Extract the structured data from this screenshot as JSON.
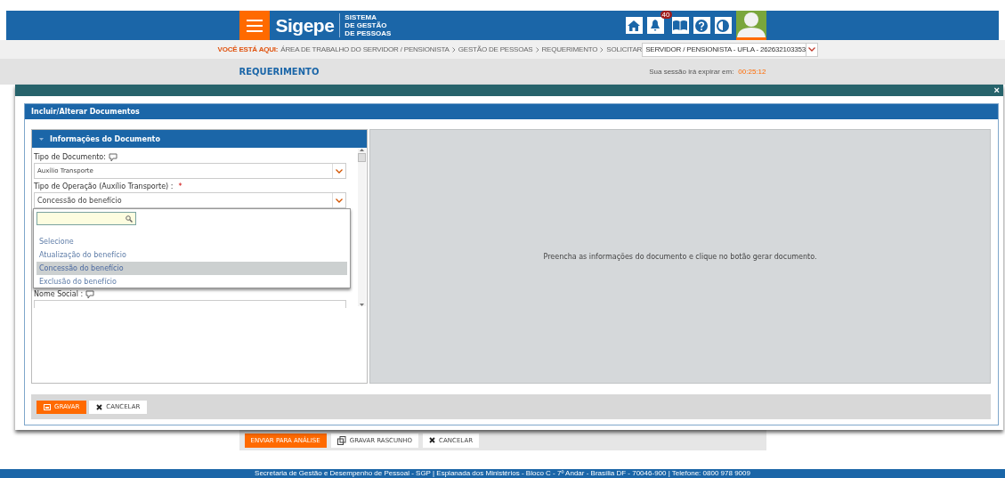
{
  "header": {
    "logo": "Sigepe",
    "subtitle_lines": [
      "SISTEMA",
      "DE GESTÃO",
      "DE PESSOAS"
    ],
    "notification_count": "40"
  },
  "breadcrumb": {
    "label": "VOCÊ ESTÁ AQUI:",
    "items": [
      "ÁREA DE TRABALHO DO SERVIDOR / PENSIONISTA",
      "GESTÃO DE PESSOAS",
      "REQUERIMENTO",
      "SOLICITAR"
    ]
  },
  "profile_select": {
    "value": "SERVIDOR / PENSIONISTA - UFLA - 262632103353"
  },
  "page_title": "REQUERIMENTO",
  "session": {
    "label": "Sua sessão irá expirar em:",
    "time": "00:25:12"
  },
  "modal": {
    "close": "×",
    "title": "Incluir/Alterar Documentos",
    "section": {
      "title": "Informações do Documento",
      "fields": [
        {
          "label": "Tipo de Documento:",
          "help": true,
          "value": "Auxílio Transporte"
        },
        {
          "label": "Tipo de Operação (Auxílio Transporte) :",
          "required_mark": "*",
          "help": false,
          "value": "Concessão do benefício"
        }
      ],
      "dropdown": {
        "options": [
          {
            "label": "Selecione",
            "selected": false
          },
          {
            "label": "Atualização do benefício",
            "selected": false
          },
          {
            "label": "Concessão do benefício",
            "selected": true
          },
          {
            "label": "Exclusão do benefício",
            "selected": false
          }
        ]
      },
      "after_field": {
        "label": "Nome Social :",
        "help": true
      }
    },
    "preview_message": "Preencha as informações do documento e clique no botão gerar documento.",
    "buttons": [
      {
        "label": "GRAVAR",
        "kind": "primary"
      },
      {
        "label": "CANCELAR",
        "kind": "cancel"
      }
    ]
  },
  "page_buttons": [
    {
      "label": "ENVIAR PARA ANÁLISE",
      "kind": "primary"
    },
    {
      "label": "GRAVAR RASCUNHO",
      "kind": "draft"
    },
    {
      "label": "CANCELAR",
      "kind": "cancel"
    }
  ],
  "footer": "Secretaria de Gestão e Desempenho de Pessoal - SGP | Esplanada dos Ministérios - Bloco C - 7º Andar - Brasília DF - 70046-900 | Telefone: 0800 978 9009"
}
